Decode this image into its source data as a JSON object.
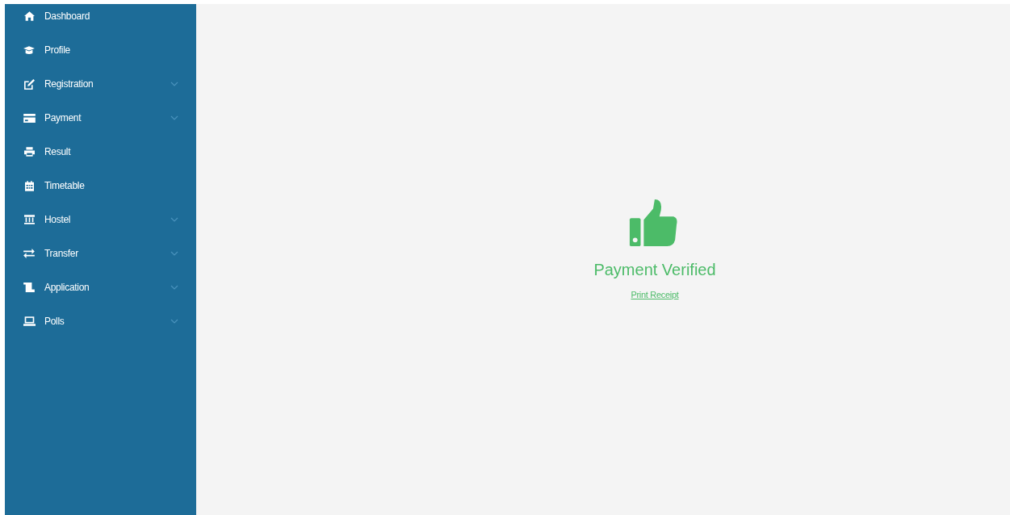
{
  "sidebar": {
    "items": [
      {
        "label": "Dashboard",
        "expandable": false
      },
      {
        "label": "Profile",
        "expandable": false
      },
      {
        "label": "Registration",
        "expandable": true
      },
      {
        "label": "Payment",
        "expandable": true
      },
      {
        "label": "Result",
        "expandable": false
      },
      {
        "label": "Timetable",
        "expandable": false
      },
      {
        "label": "Hostel",
        "expandable": true
      },
      {
        "label": "Transfer",
        "expandable": true
      },
      {
        "label": "Application",
        "expandable": true
      },
      {
        "label": "Polls",
        "expandable": true
      }
    ]
  },
  "main": {
    "status": "Payment Verified",
    "link": "Print Receipt"
  }
}
